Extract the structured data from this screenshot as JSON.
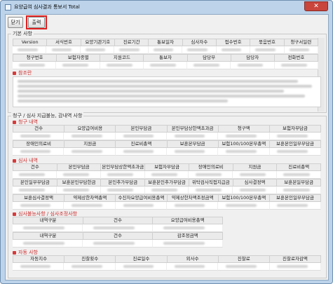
{
  "window": {
    "title": "요양급여 심사결과 통보서 Total",
    "close_glyph": "✕"
  },
  "toolbar": {
    "close_label": "닫기",
    "print_label": "출력"
  },
  "basic": {
    "title": "기본 사항",
    "row1": [
      "Version",
      "서식번호",
      "요양기관기호",
      "진료기간",
      "통보일자",
      "심사자수",
      "접수번호",
      "묶음번호",
      "청구서일련"
    ],
    "row2": [
      "청구번호",
      "보험자종별",
      "지원코드",
      "통보자",
      "담당부",
      "담당자",
      "전화번호"
    ],
    "memo_title": "참조란"
  },
  "payment": {
    "title": "청구 / 심사 지급불능, 감내역 사항",
    "claim_title": "청구 내역",
    "claim_h1": [
      "건수",
      "요양급여비용",
      "본인부담금",
      "본인부담상한액초과금",
      "청구액",
      "보험자부담금"
    ],
    "claim_h2": [
      "장애인의료비",
      "지원금",
      "진료비총액",
      "보훈본부담금",
      "보험100/100본부총액",
      "보훈본인일부부담금"
    ],
    "review_title": "심사 내역",
    "review_h1": [
      "건수",
      "본인부담금",
      "본인부담상한액초과금",
      "보험자부담금",
      "장애인의료비",
      "지원금",
      "진료비총액"
    ],
    "review_h2": [
      "본인일부부담금",
      "보훈본인부담한금",
      "본인추가부담금",
      "보훈본인추가부담금",
      "위탁검사직접지급금",
      "심사결정액",
      "보훈본일부담금"
    ],
    "review_h3": [
      "보훈심사결정액",
      "약제상한차액총액",
      "수진자요양급여비용총액",
      "약제상한차액조정금액",
      "보험100/100본부총액",
      "보훈본인일부부담금"
    ],
    "nopay_title": "심사불능사항 / 심사조정사항",
    "nopay_h1": [
      "내역구분",
      "건수",
      "요양급여비용총액"
    ],
    "nopay_h2": [
      "내역구분",
      "건수",
      "감조정금액"
    ],
    "patient_title": "자동 사항",
    "patient_h": [
      "자동지수",
      "진찰횟수",
      "진료일수",
      "외사수",
      "진찰료",
      "진찰료자감액"
    ]
  }
}
